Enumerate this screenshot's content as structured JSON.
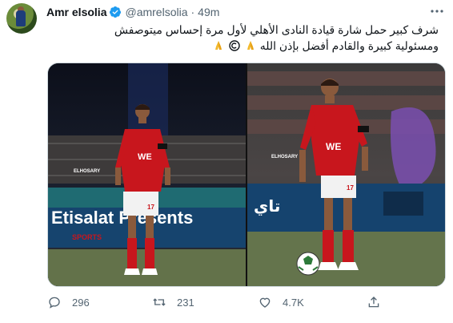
{
  "author": {
    "name": "Amr elsolia",
    "handle": "@amrelsolia",
    "separator": "·",
    "time": "49m"
  },
  "tweet": {
    "lines": [
      "شرف كبير حمل شارة قيادة النادى الأهلي  لأول مرة إحساس ميتوصفش",
      "ومسئولية كبيرة والقادم أفضل بإذن الله"
    ],
    "emojis": [
      "folded-hands",
      "copyright",
      "folded-hands"
    ]
  },
  "photos": [
    {
      "label": "left-photo",
      "watermark": "ELHOSARY",
      "sponsor_text": "Etisalat Presents",
      "sponsor_sub": "SPORTS",
      "jersey": "WE",
      "number": "17"
    },
    {
      "label": "right-photo",
      "watermark": "ELHOSARY",
      "sponsor_text": "تاي",
      "jersey": "WE",
      "number": "17"
    }
  ],
  "actions": {
    "replies": "296",
    "retweets": "231",
    "likes": "4.7K"
  },
  "colors": {
    "text": "#0f1419",
    "muted": "#536471",
    "verified": "#1d9bf0",
    "jersey_red": "#c8161d"
  }
}
